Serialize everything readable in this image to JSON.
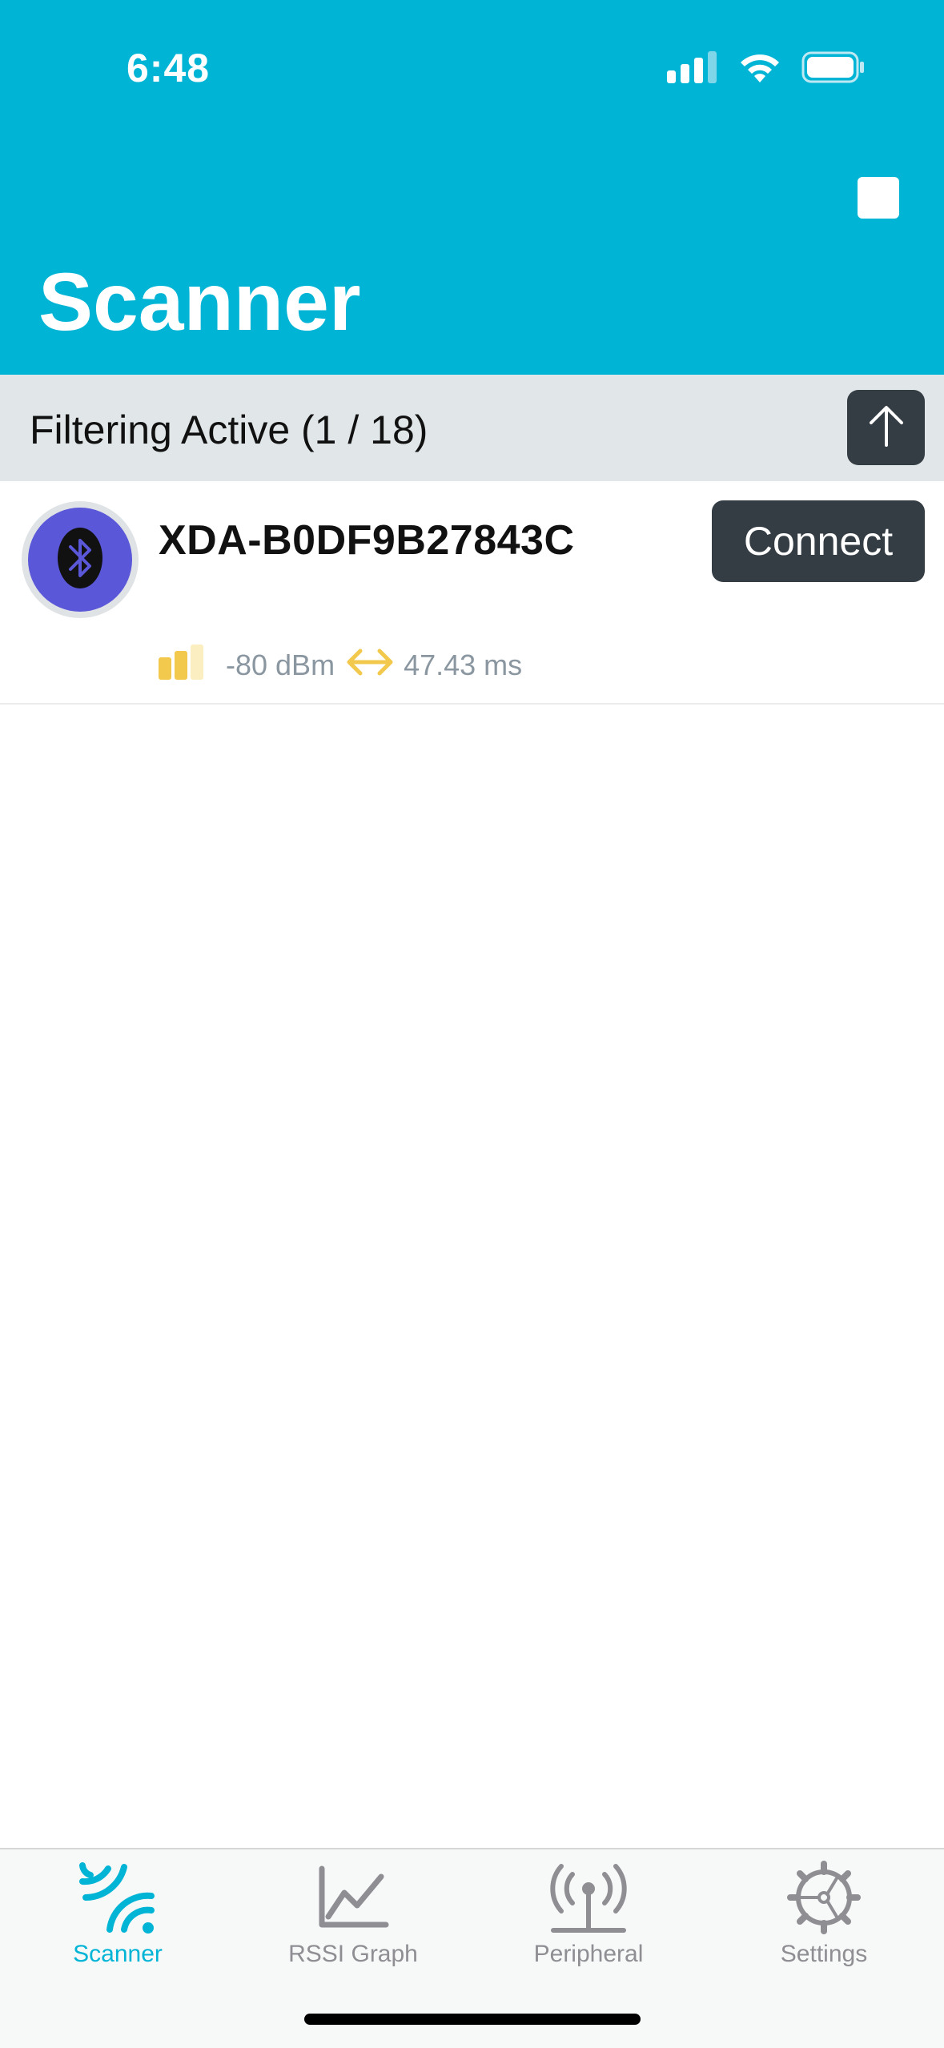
{
  "status_bar": {
    "time": "6:48"
  },
  "header": {
    "title": "Scanner",
    "background_color": "#00b4d6"
  },
  "filter_bar": {
    "text": "Filtering Active (1 / 18)"
  },
  "devices": [
    {
      "name": "XDA-B0DF9B27843C",
      "connect_label": "Connect",
      "rssi": "-80 dBm",
      "interval": "47.43 ms",
      "icon": "bluetooth-icon"
    }
  ],
  "tabs": [
    {
      "label": "Scanner",
      "icon": "scanner-icon",
      "active": true
    },
    {
      "label": "RSSI Graph",
      "icon": "graph-icon",
      "active": false
    },
    {
      "label": "Peripheral",
      "icon": "antenna-icon",
      "active": false
    },
    {
      "label": "Settings",
      "icon": "gear-icon",
      "active": false
    }
  ],
  "colors": {
    "accent": "#00b4d6",
    "button_dark": "#353d44",
    "signal": "#f2c94c",
    "inactive": "#8e8e93"
  }
}
